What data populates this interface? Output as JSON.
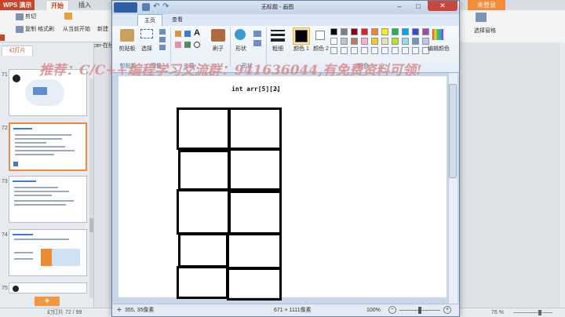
{
  "wps": {
    "app_name": "WPS 演示",
    "tabs": [
      "开始",
      "插入"
    ],
    "login_label": "未登录",
    "ribbon": {
      "cut": "剪切",
      "copy": "复制",
      "format_painter": "格式刷",
      "from_current": "从当前开始",
      "new_slide": "新建",
      "docer": "Docer-在线",
      "select_pane": "选择窗格"
    },
    "pane_tab": "幻灯片",
    "slide_numbers": [
      "71",
      "72",
      "73",
      "74",
      "75"
    ],
    "status_left": "幻灯片 72 / 99",
    "status_zoom": "76 %",
    "promo_text": "推荐：C/C++编程学习交流群：941636044,有免费资料可领!"
  },
  "paint": {
    "title": "无标题 - 画图",
    "tabs": {
      "home": "主页",
      "view": "查看"
    },
    "groups": {
      "clipboard": "剪贴板",
      "image": "图像",
      "tools": "工具",
      "shapes": "形状",
      "colors": "颜色"
    },
    "buttons": {
      "paste": "剪贴板",
      "select": "选择",
      "brushes": "刷子",
      "shapes": "形状",
      "outline": "粗细",
      "color1": "颜色 1",
      "color2": "颜色 2",
      "edit_colors": "编辑颜色"
    },
    "palette_row1": [
      "#000000",
      "#7f7f7f",
      "#880015",
      "#ed1c24",
      "#ff7f27",
      "#fff200",
      "#22b14c",
      "#00a2e8",
      "#3f48cc",
      "#a349a4"
    ],
    "palette_row2": [
      "#ffffff",
      "#c3c3c3",
      "#b97a57",
      "#ffaec9",
      "#ffc90e",
      "#efe4b0",
      "#b5e61d",
      "#99d9ea",
      "#7092be",
      "#c8bfe7"
    ],
    "color1": "#000000",
    "color2": "#ffffff",
    "canvas_text": "int arr[5][2]",
    "status": {
      "cursor": "355, 35像素",
      "size": "671 × 1111像素",
      "zoom": "100%"
    }
  },
  "window_controls": {
    "minimize": "–",
    "maximize": "□",
    "close": "✕"
  }
}
